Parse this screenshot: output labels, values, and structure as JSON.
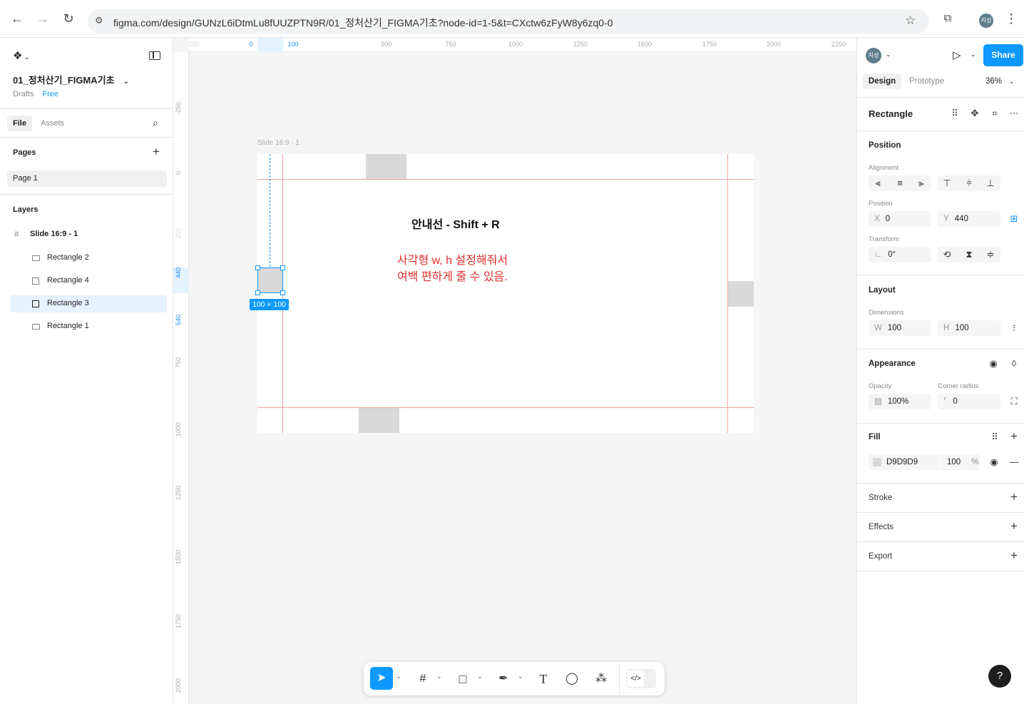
{
  "browser": {
    "url": "figma.com/design/GUNzL6iDtmLu8fUUZPTN9R/01_정처산기_FIGMA기초?node-id=1-5&t=CXctw6zFyW8y6zq0-0",
    "avatar": "지성"
  },
  "left_panel": {
    "file_name": "01_정처산기_FIGMA기초",
    "drafts": "Drafts",
    "plan": "Free",
    "tabs": [
      "File",
      "Assets"
    ],
    "pages_title": "Pages",
    "pages": [
      "Page 1"
    ],
    "layers_title": "Layers",
    "frame": "Slide 16:9 - 1",
    "layers": [
      "Rectangle 2",
      "Rectangle 4",
      "Rectangle 3",
      "Rectangle 1"
    ],
    "selected_layer": "Rectangle 3"
  },
  "canvas": {
    "ruler_h": [
      "250",
      "0",
      "100",
      "500",
      "750",
      "1000",
      "1250",
      "1500",
      "1750",
      "2000",
      "2250"
    ],
    "ruler_v": [
      "-250",
      "0",
      "250",
      "440",
      "540",
      "750",
      "1000",
      "1250",
      "1500",
      "1750",
      "2000"
    ],
    "frame_label": "Slide 16:9 - 1",
    "text_heading": "안내선 - Shift + R",
    "text_red_line1": "사각형 w, h 설정해줘서",
    "text_red_line2": "여백 편하게 줄 수 있음.",
    "size_badge": "100 × 100",
    "guide_color": "#f3a3a3",
    "accent": "#0d99ff",
    "text_red_color": "#e03030"
  },
  "right_panel": {
    "avatar": "지성",
    "share": "Share",
    "tabs": [
      "Design",
      "Prototype"
    ],
    "zoom": "36%",
    "selection_title": "Rectangle",
    "position_title": "Position",
    "alignment_label": "Alignment",
    "position_label": "Position",
    "x_label": "X",
    "x_value": "0",
    "y_label": "Y",
    "y_value": "440",
    "transform_label": "Transform",
    "rotation": "0°",
    "layout_title": "Layout",
    "dimensions_label": "Dimensions",
    "w_label": "W",
    "w_value": "100",
    "h_label": "H",
    "h_value": "100",
    "appearance_title": "Appearance",
    "opacity_label": "Opacity",
    "opacity_value": "100%",
    "radius_label": "Corner radius",
    "radius_value": "0",
    "fill_title": "Fill",
    "fill_hex": "D9D9D9",
    "fill_opacity": "100",
    "fill_pct": "%",
    "fill_color": "#d9d9d9",
    "stroke_title": "Stroke",
    "effects_title": "Effects",
    "export_title": "Export"
  },
  "help": "?"
}
